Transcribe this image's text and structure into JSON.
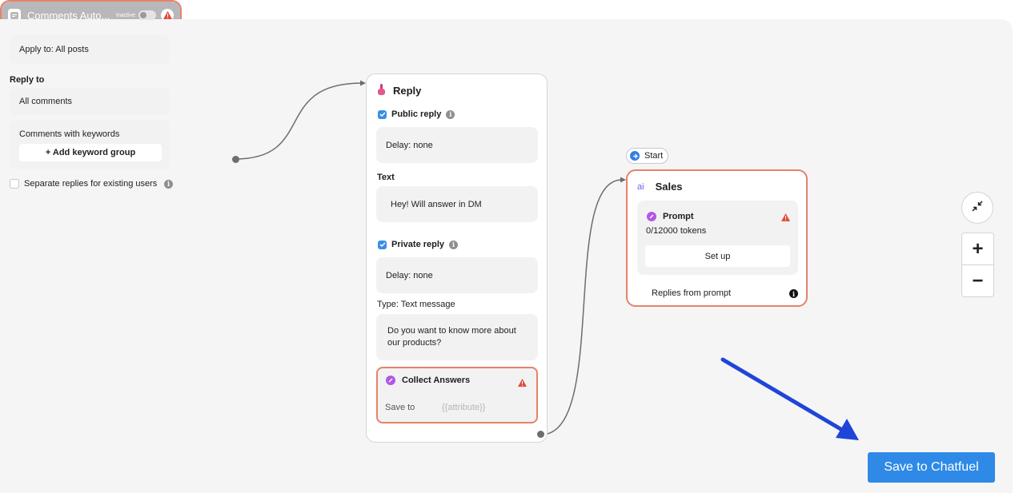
{
  "comments_node": {
    "title": "Comments Auto...",
    "status": "Inactive",
    "apply_to": "Apply to: All posts",
    "reply_to_label": "Reply to",
    "all_comments": "All comments",
    "keywords_label": "Comments with keywords",
    "add_keyword_group": "+ Add keyword group",
    "separate_replies_label": "Separate replies for existing users",
    "separate_replies_checked": false
  },
  "reply_node": {
    "title": "Reply",
    "public_reply_label": "Public reply",
    "public_reply_checked": true,
    "public_delay": "Delay: none",
    "text_label": "Text",
    "public_text": "Hey! Will answer in DM",
    "private_reply_label": "Private reply",
    "private_reply_checked": true,
    "private_delay": "Delay: none",
    "type_label": "Type:  Text message",
    "private_text": "Do you want to know more about our products?",
    "collect_title": "Collect Answers",
    "save_to_label": "Save to",
    "attribute_placeholder": "{{attribute}}"
  },
  "start_pill": {
    "label": "Start"
  },
  "sales_node": {
    "icon_text": "ai",
    "title": "Sales",
    "prompt_title": "Prompt",
    "tokens": "0/12000 tokens",
    "setup_label": "Set up",
    "replies_label": "Replies from prompt"
  },
  "zoom": {
    "zoom_in": "+",
    "zoom_out": "−"
  },
  "save_button": {
    "label": "Save to Chatfuel"
  },
  "colors": {
    "accent": "#2e8ae6",
    "warning_border": "#e6826b",
    "warning_icon": "#e34b3b",
    "annotation_arrow": "#1f45d8"
  }
}
